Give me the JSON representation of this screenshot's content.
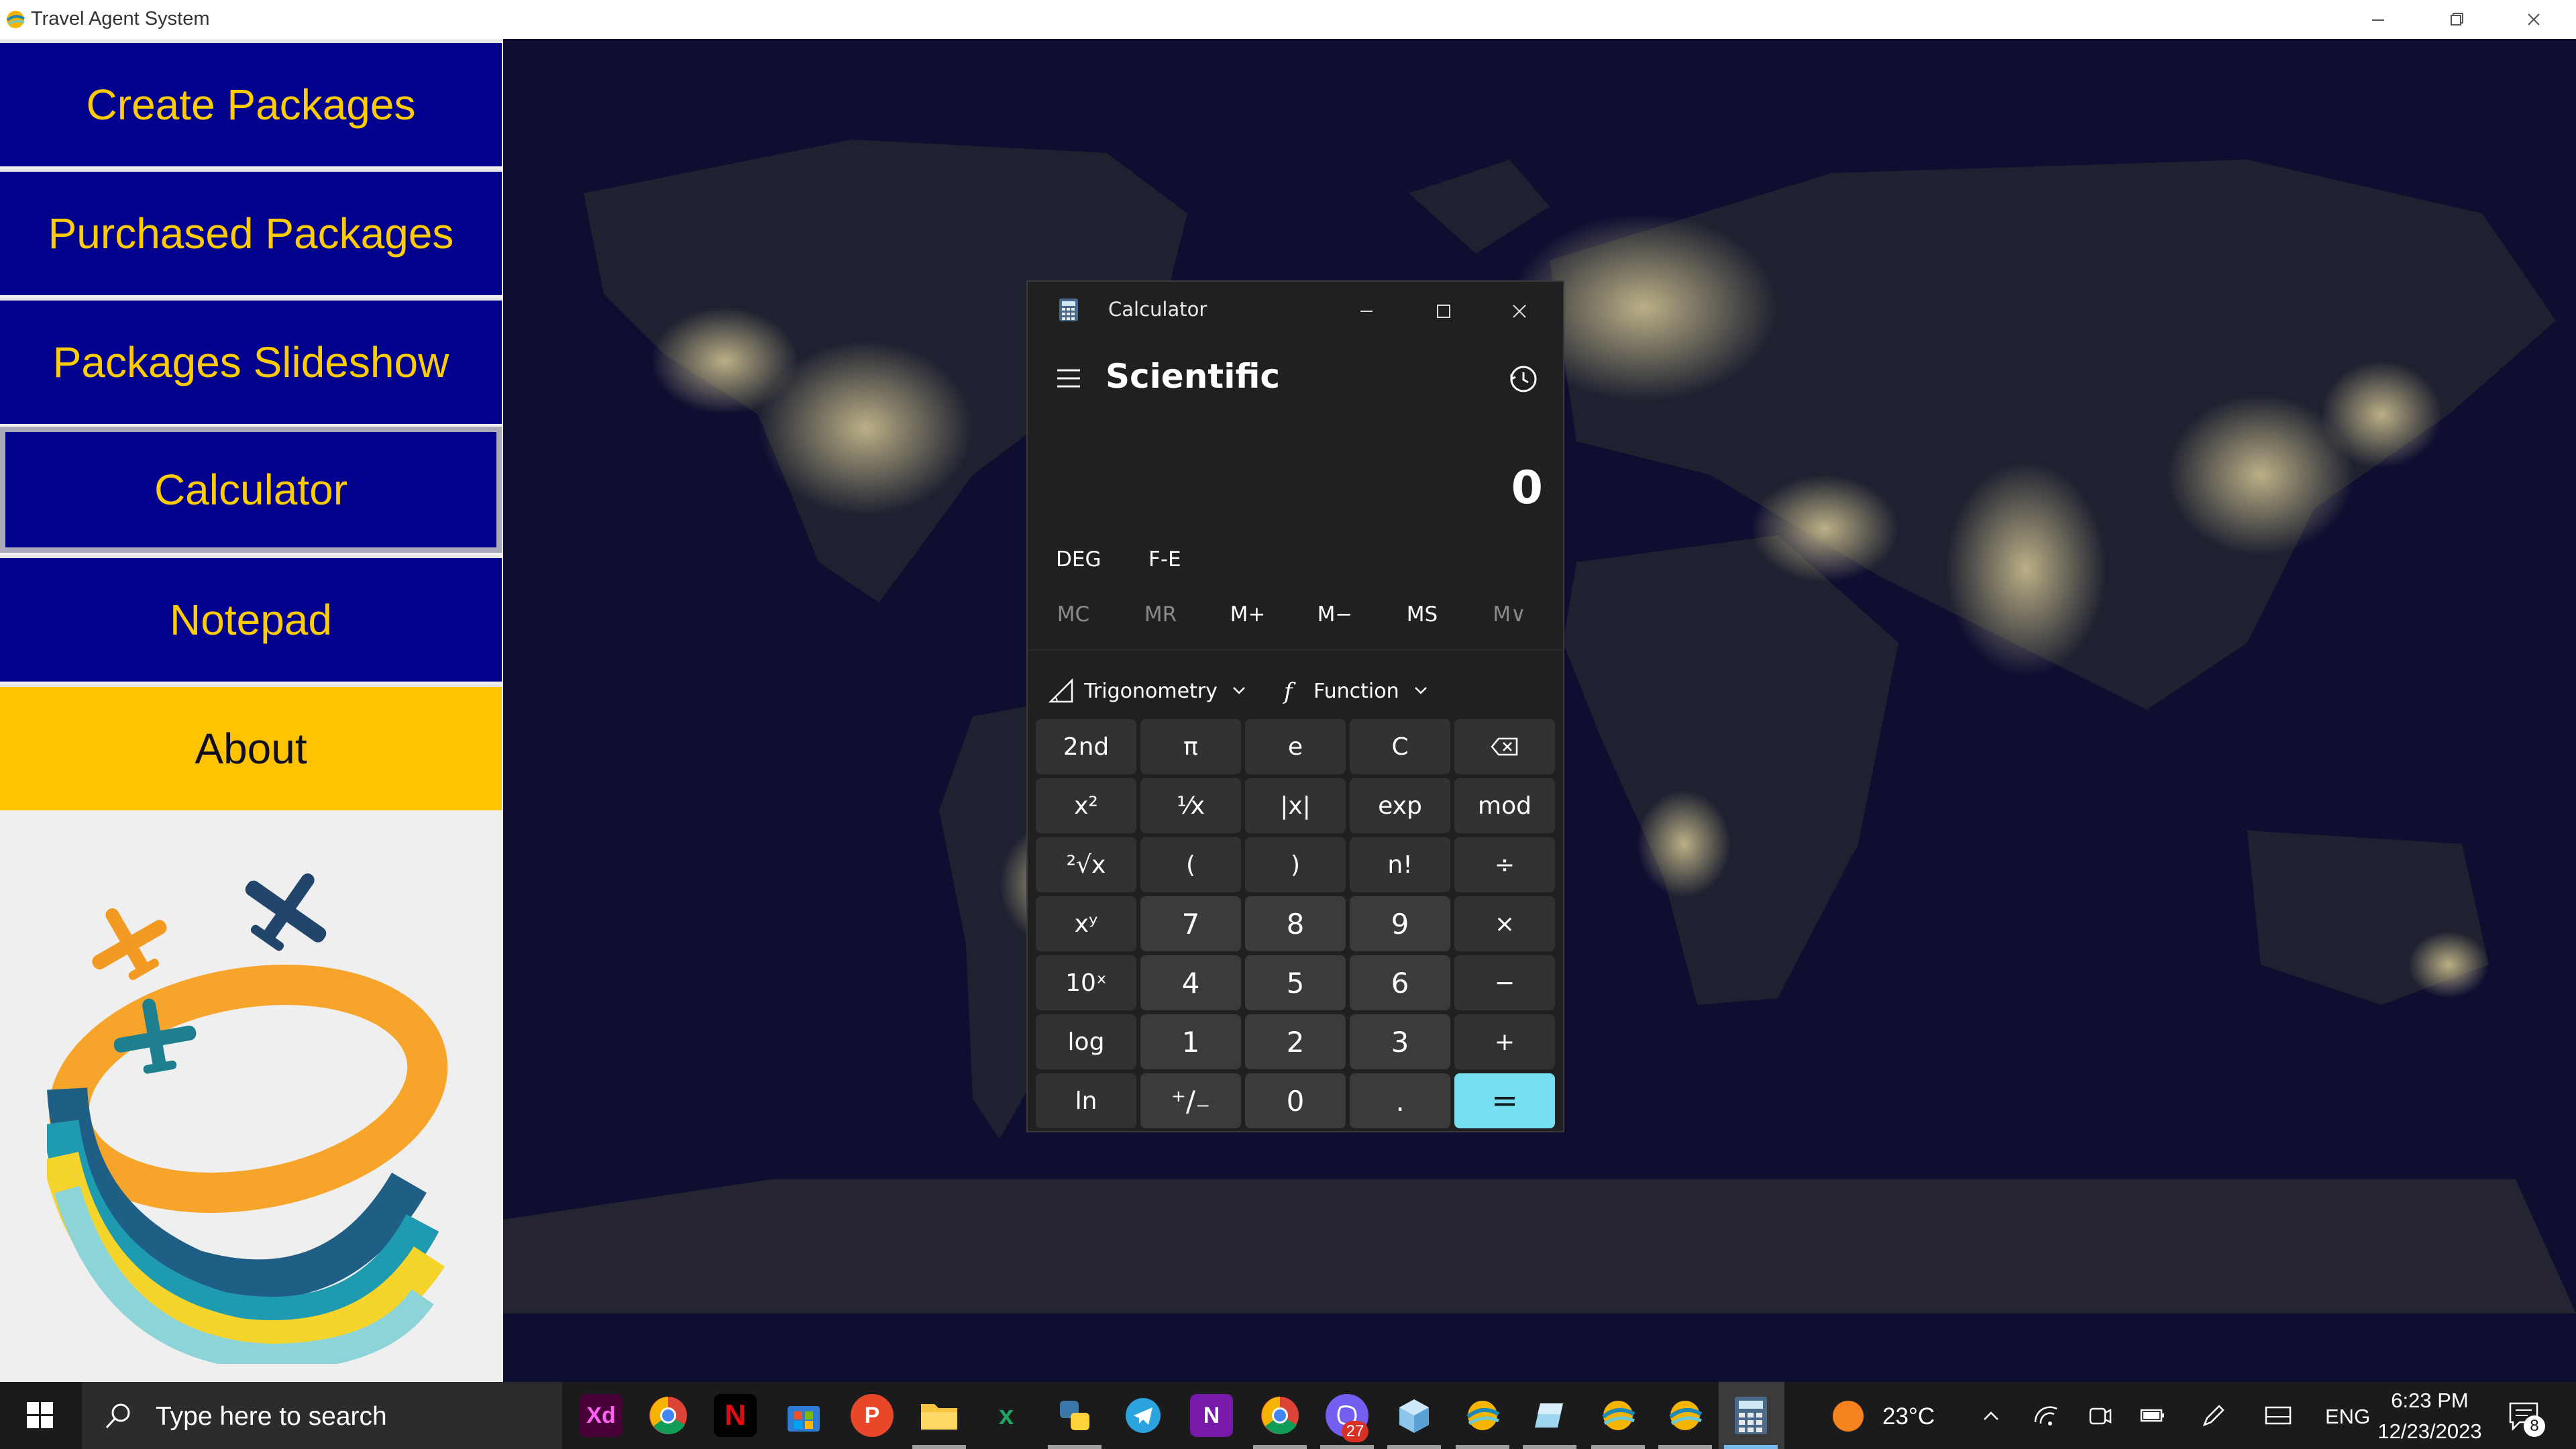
{
  "window": {
    "title": "Travel Agent System"
  },
  "sidebar": {
    "items": [
      {
        "label": "Create Packages"
      },
      {
        "label": "Purchased Packages"
      },
      {
        "label": "Packages Slideshow"
      },
      {
        "label": "Calculator"
      },
      {
        "label": "Notepad"
      },
      {
        "label": "About"
      }
    ],
    "active_item": "Calculator",
    "highlight_item": "About"
  },
  "calculator": {
    "window_title": "Calculator",
    "mode": "Scientific",
    "display": "0",
    "angle_unit": "DEG",
    "fe_label": "F-E",
    "memory": [
      "MC",
      "MR",
      "M+",
      "M−",
      "MS",
      "M∨"
    ],
    "trig_label": "Trigonometry",
    "function_label": "Function",
    "keys": [
      [
        "2nd",
        "π",
        "e",
        "C",
        "backspace"
      ],
      [
        "x²",
        "¹⁄x",
        "|x|",
        "exp",
        "mod"
      ],
      [
        "²√x",
        "(",
        ")",
        "n!",
        "÷"
      ],
      [
        "xʸ",
        "7",
        "8",
        "9",
        "×"
      ],
      [
        "10ˣ",
        "4",
        "5",
        "6",
        "−"
      ],
      [
        "log",
        "1",
        "2",
        "3",
        "+"
      ],
      [
        "ln",
        "⁺/₋",
        "0",
        ".",
        "="
      ]
    ],
    "colors": {
      "equals": "#76e0f2",
      "background": "#202020"
    }
  },
  "taskbar": {
    "search_placeholder": "Type here to search",
    "apps": [
      "Adobe XD",
      "Chrome",
      "Netflix",
      "Microsoft Store",
      "Parsec",
      "File Explorer",
      "Excel",
      "Python",
      "Telegram",
      "OneNote",
      "Chrome Profile",
      "Viber",
      "3D Viewer",
      "Travel Agent System",
      "Notes",
      "Travel Agent System",
      "Travel Agent System",
      "Calculator"
    ],
    "viber_badge": "27",
    "weather_temp": "23°C",
    "language": "ENG",
    "time": "6:23 PM",
    "date": "12/23/2023",
    "notification_count": "8"
  }
}
